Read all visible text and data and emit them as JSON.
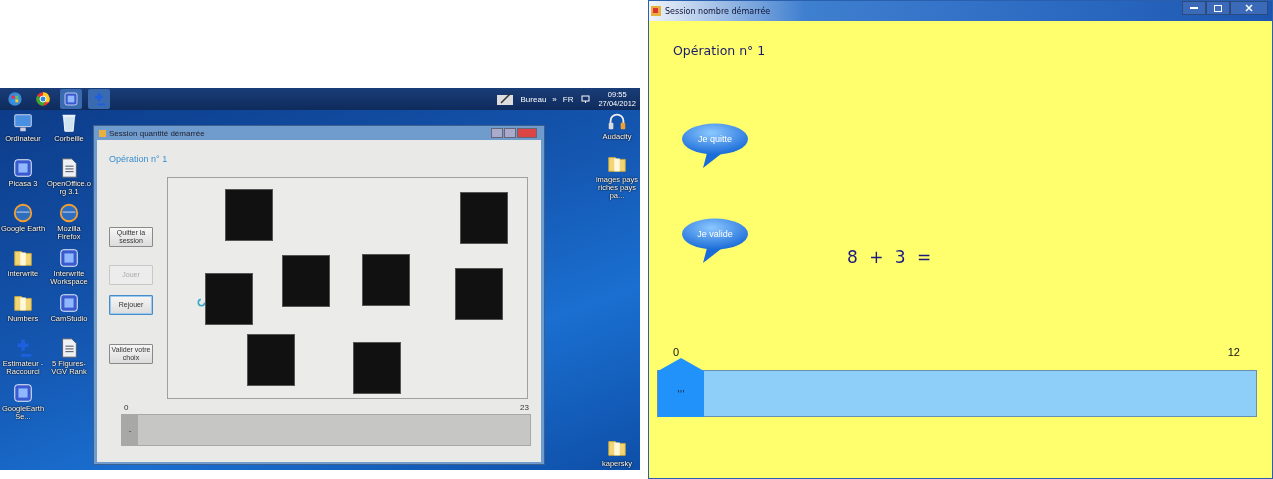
{
  "desktop": {
    "taskbar": {
      "pinned": [
        {
          "kind": "start"
        },
        {
          "kind": "browser"
        },
        {
          "kind": "app"
        },
        {
          "kind": "plus"
        }
      ],
      "tray_items": [
        "Bureau",
        "»",
        "FR"
      ],
      "time": "09:55",
      "date": "27/04/2012"
    },
    "icons": [
      {
        "label": "Ordinateur",
        "kind": "computer"
      },
      {
        "label": "Corbeille",
        "kind": "trash"
      },
      {
        "label": "Picasa 3",
        "kind": "app"
      },
      {
        "label": "OpenOffice.org 3.1",
        "kind": "document"
      },
      {
        "label": "Google Earth",
        "kind": "globe"
      },
      {
        "label": "Mozilla Firefox",
        "kind": "globe"
      },
      {
        "label": "interwrite",
        "kind": "folder"
      },
      {
        "label": "Interwrite Workspace",
        "kind": "app"
      },
      {
        "label": "Numbers",
        "kind": "folder"
      },
      {
        "label": "CamStudio",
        "kind": "app"
      },
      {
        "label": "Estimateur - Raccourci",
        "kind": "plus"
      },
      {
        "label": "5 Figures-VGV Rank",
        "kind": "document"
      },
      {
        "label": "GoogleEarthSe...",
        "kind": "app"
      }
    ],
    "right_icons": [
      {
        "label": "Audacity",
        "kind": "headphones"
      },
      {
        "label": "images pays riches pays pa...",
        "kind": "folder"
      },
      {
        "label": "kapersky",
        "kind": "folder"
      }
    ],
    "window": {
      "title": "Session quantité démarrée",
      "heading": "Opération n° 1",
      "buttons": [
        {
          "label": "Quitter la session",
          "disabled": false,
          "focused": false
        },
        {
          "label": "Jouer",
          "disabled": true,
          "focused": false
        },
        {
          "label": "Rejouer",
          "disabled": false,
          "focused": true
        },
        {
          "label": "Valider votre choix",
          "disabled": false,
          "focused": false
        }
      ],
      "scale": {
        "min": "0",
        "max": "23",
        "thumb_label": "-",
        "level": 0
      }
    }
  },
  "window": {
    "title": "Session nombre démarrée",
    "heading": "Opération n° 1",
    "buttons": [
      "Je quitte",
      "Je valide"
    ],
    "equation": "8 + 3 =",
    "scale": {
      "min": "0",
      "max": "12",
      "thumb_label": "'''",
      "level": 0
    }
  }
}
